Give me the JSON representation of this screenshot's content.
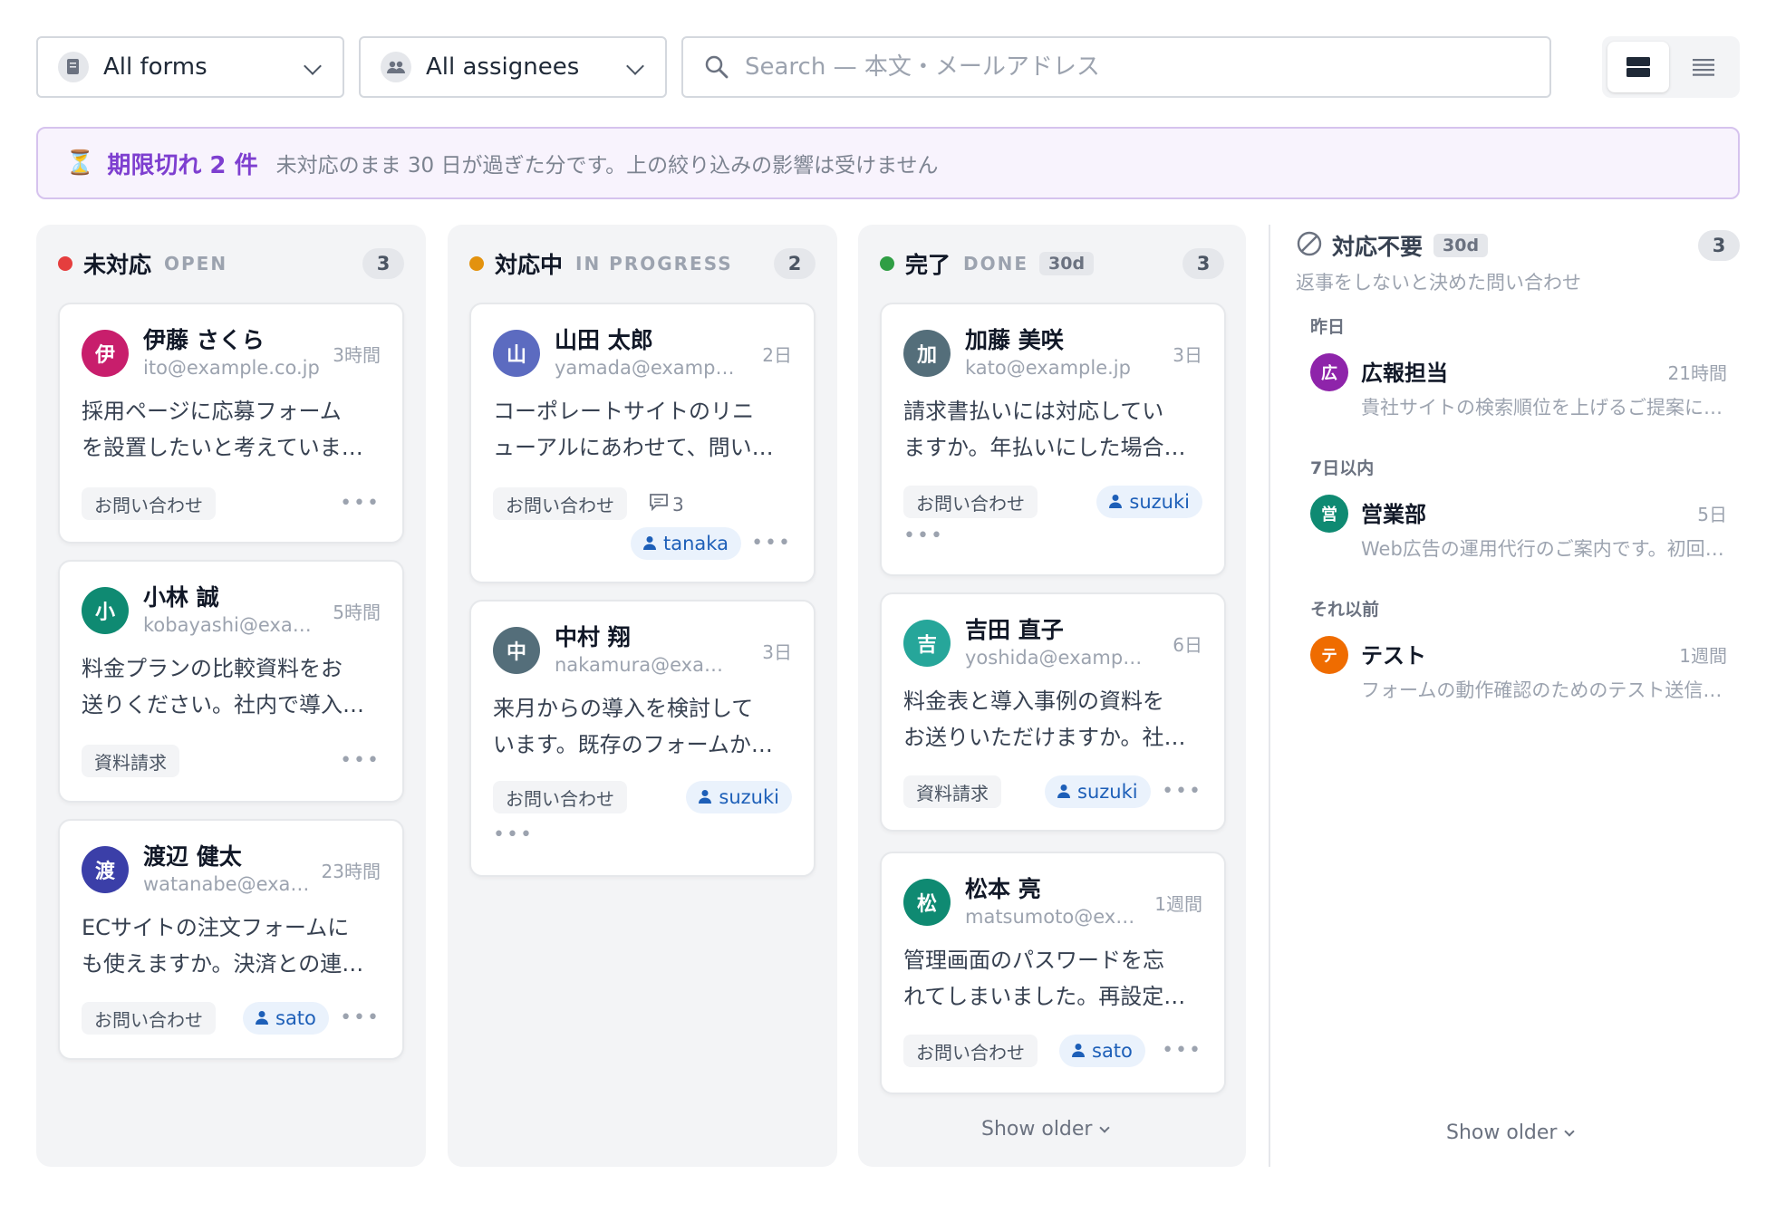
{
  "filters": {
    "forms_label": "All forms",
    "assignees_label": "All assignees",
    "search_placeholder": "Search — 本文・メールアドレス"
  },
  "banner": {
    "icon": "hourglass-icon",
    "title": "期限切れ 2 件",
    "description": "未対応のまま 30 日が過ぎた分です。上の絞り込みの影響は受けません"
  },
  "columns": {
    "open": {
      "title": "未対応",
      "subtitle": "OPEN",
      "count": "3",
      "color": "#e53e3e",
      "cards": [
        {
          "initial": "伊",
          "color": "#c81e6c",
          "name": "伊藤 さくら",
          "email": "ito@example.co.jp",
          "time": "3時間",
          "line1": "採用ページに応募フォーム",
          "line2": "を設置したいと考えていま…",
          "tag": "お問い合わせ"
        },
        {
          "initial": "小",
          "color": "#0f8a72",
          "name": "小林 誠",
          "email": "kobayashi@exa…",
          "time": "5時間",
          "line1": "料金プランの比較資料をお",
          "line2": "送りください。社内で導入…",
          "tag": "資料請求"
        },
        {
          "initial": "渡",
          "color": "#3b3fa8",
          "name": "渡辺 健太",
          "email": "watanabe@exa…",
          "time": "23時間",
          "line1": "ECサイトの注文フォームに",
          "line2": "も使えますか。決済との連…",
          "tag": "お問い合わせ",
          "assignee": "sato"
        }
      ]
    },
    "in_progress": {
      "title": "対応中",
      "subtitle": "IN PROGRESS",
      "count": "2",
      "color": "#e3920e",
      "cards": [
        {
          "initial": "山",
          "color": "#5c6bc0",
          "name": "山田 太郎",
          "email": "yamada@example.…",
          "time": "2日",
          "line1": "コーポレートサイトのリニ",
          "line2": "ューアルにあわせて、問い…",
          "tag": "お問い合わせ",
          "comments": "3",
          "assignee": "tanaka"
        },
        {
          "initial": "中",
          "color": "#546e7a",
          "name": "中村 翔",
          "email": "nakamura@exampl…",
          "time": "3日",
          "line1": "来月からの導入を検討して",
          "line2": "います。既存のフォームか…",
          "tag": "お問い合わせ",
          "assignee": "suzuki"
        }
      ]
    },
    "done": {
      "title": "完了",
      "subtitle": "DONE",
      "badge": "30d",
      "count": "3",
      "color": "#2f9e44",
      "cards": [
        {
          "initial": "加",
          "color": "#546e7a",
          "name": "加藤 美咲",
          "email": "kato@example.jp",
          "time": "3日",
          "line1": "請求書払いには対応してい",
          "line2": "ますか。年払いにした場合…",
          "tag": "お問い合わせ",
          "assignee": "suzuki"
        },
        {
          "initial": "吉",
          "color": "#26a69a",
          "name": "吉田 直子",
          "email": "yoshida@example.…",
          "time": "6日",
          "line1": "料金表と導入事例の資料を",
          "line2": "お送りいただけますか。社…",
          "tag": "資料請求",
          "assignee": "suzuki"
        },
        {
          "initial": "松",
          "color": "#0f8a72",
          "name": "松本 亮",
          "email": "matsumoto@exa…",
          "time": "1週間",
          "line1": "管理画面のパスワードを忘",
          "line2": "れてしまいました。再設定…",
          "tag": "お問い合わせ",
          "assignee": "sato"
        }
      ],
      "show_older": "Show older"
    }
  },
  "no_reply": {
    "title": "対応不要",
    "badge": "30d",
    "count": "3",
    "description": "返事をしないと決めた問い合わせ",
    "groups": [
      {
        "label": "昨日",
        "item": {
          "initial": "広",
          "color": "#8e24aa",
          "name": "広報担当",
          "time": "21時間",
          "preview": "貴社サイトの検索順位を上げるご提案について"
        }
      },
      {
        "label": "7日以内",
        "item": {
          "initial": "営",
          "color": "#0f8a72",
          "name": "営業部",
          "time": "5日",
          "preview": "Web広告の運用代行のご案内です。初回無料"
        }
      },
      {
        "label": "それ以前",
        "item": {
          "initial": "テ",
          "color": "#ef6c00",
          "name": "テスト",
          "time": "1週間",
          "preview": "フォームの動作確認のためのテスト送信です"
        }
      }
    ],
    "show_older": "Show older"
  }
}
